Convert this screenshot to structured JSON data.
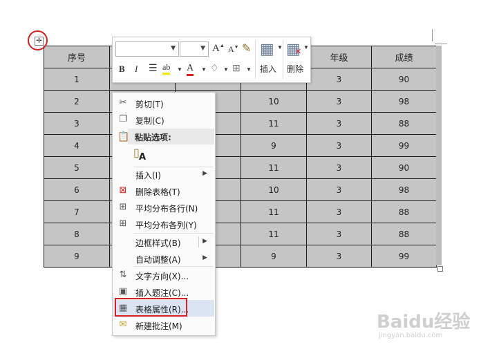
{
  "table": {
    "headers": [
      "序号",
      "",
      "",
      "",
      "年级",
      "成绩"
    ],
    "rows": [
      [
        "1",
        "",
        "",
        "",
        "3",
        "90"
      ],
      [
        "2",
        "",
        "",
        "10",
        "3",
        "98"
      ],
      [
        "3",
        "",
        "",
        "11",
        "3",
        "88"
      ],
      [
        "4",
        "",
        "",
        "9",
        "3",
        "99"
      ],
      [
        "5",
        "",
        "",
        "11",
        "3",
        "90"
      ],
      [
        "6",
        "",
        "",
        "10",
        "3",
        "98"
      ],
      [
        "7",
        "",
        "",
        "11",
        "3",
        "88"
      ],
      [
        "8",
        "",
        "",
        "11",
        "3",
        "88"
      ],
      [
        "9",
        "",
        "",
        "9",
        "3",
        "99"
      ]
    ]
  },
  "mini_toolbar": {
    "font_name": "",
    "font_size": "",
    "grow_font": "A",
    "shrink_font": "A",
    "bold": "B",
    "italic": "I",
    "font_color": "A",
    "insert_label": "插入",
    "delete_label": "删除"
  },
  "context_menu": {
    "cut": "剪切(T)",
    "copy": "复制(C)",
    "paste_options_header": "粘贴选项:",
    "paste_keep_text": "A",
    "insert": "插入(I)",
    "delete_table": "删除表格(T)",
    "distribute_rows": "平均分布各行(N)",
    "distribute_columns": "平均分布各列(Y)",
    "border_styles": "边框样式(B)",
    "autofit": "自动调整(A)",
    "text_direction": "文字方向(X)...",
    "insert_caption": "插入题注(C)...",
    "table_properties": "表格属性(R)...",
    "new_comment": "新建批注(M)"
  },
  "watermark": {
    "text": "Baidu经验",
    "sub": "jingyan.baidu.com"
  },
  "colors": {
    "table_fill": "#c5c5c5",
    "highlight_red": "#d82020",
    "menu_hover": "#dbe4f2"
  }
}
